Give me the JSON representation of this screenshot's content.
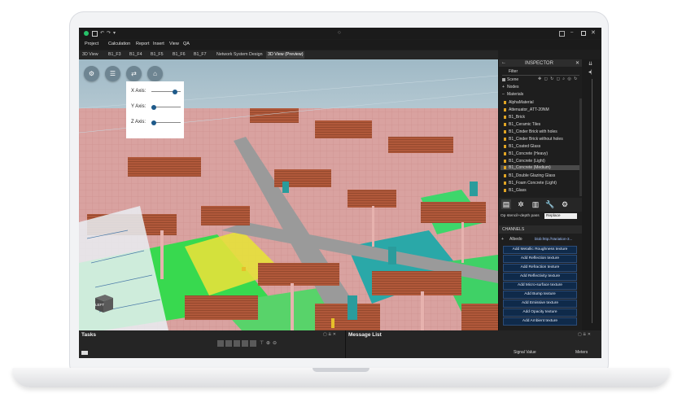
{
  "menu": {
    "items": [
      "Project",
      "Calculation",
      "Report",
      "Insert",
      "View",
      "QA"
    ]
  },
  "tabs": [
    "3D View",
    "B1_F3",
    "B1_F4",
    "B1_F5",
    "B1_F6",
    "B1_F7",
    "Network System Design",
    "3D View (Preview)"
  ],
  "viewport": {
    "axis_panel": {
      "x_label": "X Axis:",
      "y_label": "Y Axis:",
      "z_label": "Z Axis:",
      "x_level": 0.85,
      "y_level": 0.0,
      "z_level": 0.0
    },
    "nav_cube_label": "LEFT"
  },
  "inspector": {
    "title": "INSPECTOR",
    "filter_label": "Filter",
    "scene_label": "Scene",
    "nodes_label": "Nodes",
    "materials_label": "Materials",
    "materials": [
      "AlphaMaterial",
      "Attenuator_ATT-20NM",
      "B1_Brick",
      "B1_Ceramic Tiles",
      "B1_Cinder Brick with holes",
      "B1_Cinder Brick without holes",
      "B1_Coated Glass",
      "B1_Concrete (Heavy)",
      "B1_Concrete (Light)",
      "B1_Concrete (Medium)",
      "B1_Double Glazing Glass",
      "B1_Foam Concrete (Light)",
      "B1_Glass"
    ],
    "selected_index": 9,
    "op_stencil_label": "Op stencil+depth pass",
    "op_stencil_value": "Replace",
    "channels_label": "CHANNELS",
    "albedo_label": "Albedo",
    "albedo_value": "blob:http://Variation-3...",
    "channel_buttons": [
      "Add Metallic Roughness texture",
      "Add Reflection texture",
      "Add Refraction texture",
      "Add Reflectivity texture",
      "Add Micro-surface texture",
      "Add Bump texture",
      "Add Emissive texture",
      "Add Opacity texture",
      "Add Ambient texture"
    ]
  },
  "bottom": {
    "tasks_title": "Tasks",
    "message_title": "Message List",
    "col_signal": "Signal Value",
    "col_meters": "Meters"
  },
  "colors": {
    "accent": "#0f2a4a",
    "brick": "#b0583a",
    "wall_pink": "#d9a2a0",
    "heat_green": "#32d94a",
    "heat_teal": "#2aa8a8",
    "slider_blue": "#1e5a8a"
  }
}
